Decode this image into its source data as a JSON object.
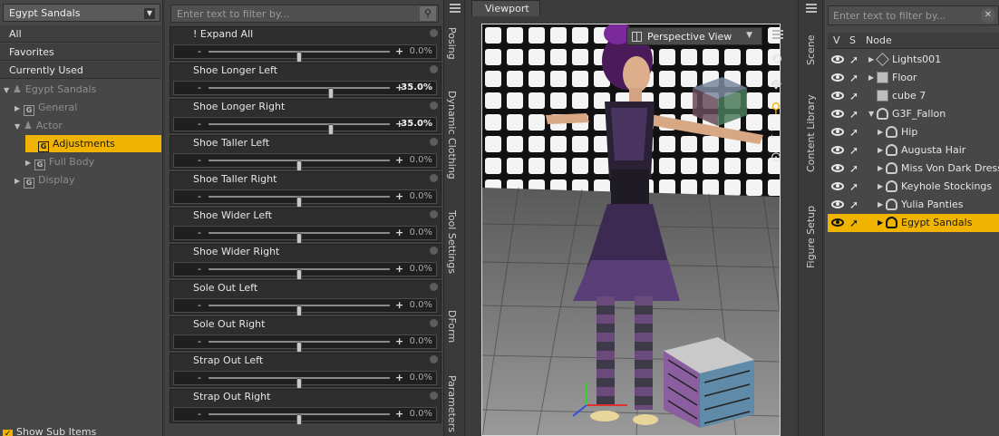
{
  "left_panel": {
    "node_selector": "Egypt Sandals",
    "categories": [
      "All",
      "Favorites",
      "Currently Used"
    ],
    "tree": [
      {
        "label": "Egypt Sandals",
        "level": 0,
        "expand": "▼",
        "icon": "figure-icon"
      },
      {
        "label": "General",
        "level": 1,
        "expand": "▶",
        "icon": "G"
      },
      {
        "label": "Actor",
        "level": 1,
        "expand": "▼",
        "icon": "figure-icon"
      },
      {
        "label": "Adjustments",
        "level": 2,
        "expand": "",
        "icon": "G",
        "selected": true
      },
      {
        "label": "Full Body",
        "level": 2,
        "expand": "▶",
        "icon": "G"
      },
      {
        "label": "Display",
        "level": 1,
        "expand": "▶",
        "icon": "G"
      }
    ],
    "show_sub_items": "Show Sub Items"
  },
  "parameters": {
    "filter_placeholder": "Enter text to filter by...",
    "items": [
      {
        "name": "! Expand All",
        "value": "0.0%",
        "fraction": 0.5,
        "active": false
      },
      {
        "name": "Shoe Longer Left",
        "value": "35.0%",
        "fraction": 0.675,
        "active": true
      },
      {
        "name": "Shoe Longer Right",
        "value": "35.0%",
        "fraction": 0.675,
        "active": true
      },
      {
        "name": "Shoe Taller Left",
        "value": "0.0%",
        "fraction": 0.5,
        "active": false
      },
      {
        "name": "Shoe Taller Right",
        "value": "0.0%",
        "fraction": 0.5,
        "active": false
      },
      {
        "name": "Shoe Wider Left",
        "value": "0.0%",
        "fraction": 0.5,
        "active": false
      },
      {
        "name": "Shoe Wider Right",
        "value": "0.0%",
        "fraction": 0.5,
        "active": false
      },
      {
        "name": "Sole Out Left",
        "value": "0.0%",
        "fraction": 0.5,
        "active": false
      },
      {
        "name": "Sole Out Right",
        "value": "0.0%",
        "fraction": 0.5,
        "active": false
      },
      {
        "name": "Strap Out Left",
        "value": "0.0%",
        "fraction": 0.5,
        "active": false
      },
      {
        "name": "Strap Out Right",
        "value": "0.0%",
        "fraction": 0.5,
        "active": false
      }
    ],
    "minus": "-",
    "plus": "+"
  },
  "side_tabs_left": [
    "Posing",
    "Dynamic Clothing",
    "Tool Settings",
    "DForm",
    "Parameters"
  ],
  "viewport": {
    "tab": "Viewport",
    "camera": "Perspective View",
    "nav_icons": [
      "orbit-icon",
      "pan-icon",
      "zoom-icon",
      "frame-icon",
      "reset-icon"
    ]
  },
  "side_tabs_right": [
    "Scene",
    "Content Library",
    "Figure Setup"
  ],
  "scene": {
    "filter_placeholder": "Enter text to filter by...",
    "columns": {
      "v": "V",
      "s": "S",
      "node": "Node"
    },
    "nodes": [
      {
        "label": "Lights001",
        "indent": 0,
        "expand": "▶",
        "icon": "light-icon"
      },
      {
        "label": "Floor",
        "indent": 0,
        "expand": "▶",
        "icon": "cube-icon"
      },
      {
        "label": "cube 7",
        "indent": 0,
        "expand": "",
        "icon": "cube-icon"
      },
      {
        "label": "G3F_Fallon",
        "indent": 0,
        "expand": "▼",
        "icon": "figure-icon"
      },
      {
        "label": "Hip",
        "indent": 1,
        "expand": "▶",
        "icon": "figure-icon"
      },
      {
        "label": "Augusta Hair",
        "indent": 1,
        "expand": "▶",
        "icon": "figure-icon"
      },
      {
        "label": "Miss Von Dark Dress",
        "indent": 1,
        "expand": "▶",
        "icon": "figure-icon"
      },
      {
        "label": "Keyhole Stockings",
        "indent": 1,
        "expand": "▶",
        "icon": "figure-icon"
      },
      {
        "label": "Yulia Panties",
        "indent": 1,
        "expand": "▶",
        "icon": "figure-icon"
      },
      {
        "label": "Egypt Sandals",
        "indent": 1,
        "expand": "▶",
        "icon": "figure-icon",
        "selected": true
      }
    ]
  },
  "colors": {
    "accent": "#f0b400",
    "panel": "#474747",
    "dark": "#2e2e2e"
  }
}
